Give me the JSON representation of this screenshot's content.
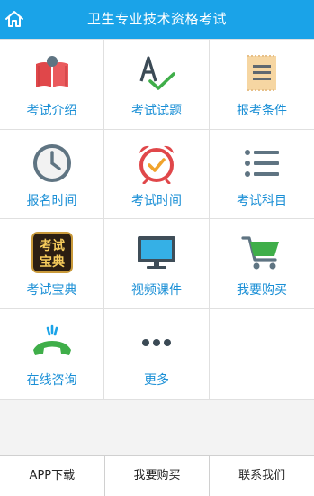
{
  "header": {
    "title": "卫生专业技术资格考试",
    "home_icon": "home-icon"
  },
  "grid": [
    {
      "label": "考试介绍",
      "icon": "book-icon"
    },
    {
      "label": "考试试题",
      "icon": "grade-check-icon"
    },
    {
      "label": "报考条件",
      "icon": "document-icon"
    },
    {
      "label": "报名时间",
      "icon": "clock-icon"
    },
    {
      "label": "考试时间",
      "icon": "alarm-clock-icon"
    },
    {
      "label": "考试科目",
      "icon": "list-icon"
    },
    {
      "label": "考试宝典",
      "icon": "exam-book-logo",
      "logo_text": "考试宝典"
    },
    {
      "label": "视频课件",
      "icon": "monitor-icon"
    },
    {
      "label": "我要购买",
      "icon": "cart-icon"
    },
    {
      "label": "在线咨询",
      "icon": "phone-icon"
    },
    {
      "label": "更多",
      "icon": "more-icon"
    }
  ],
  "footer": {
    "app_download": "APP下载",
    "buy": "我要购买",
    "contact": "联系我们"
  },
  "colors": {
    "header": "#1aa3e8",
    "label": "#1a8fd6",
    "red": "#e0474a",
    "green": "#3fae49",
    "gray": "#5f7482"
  }
}
